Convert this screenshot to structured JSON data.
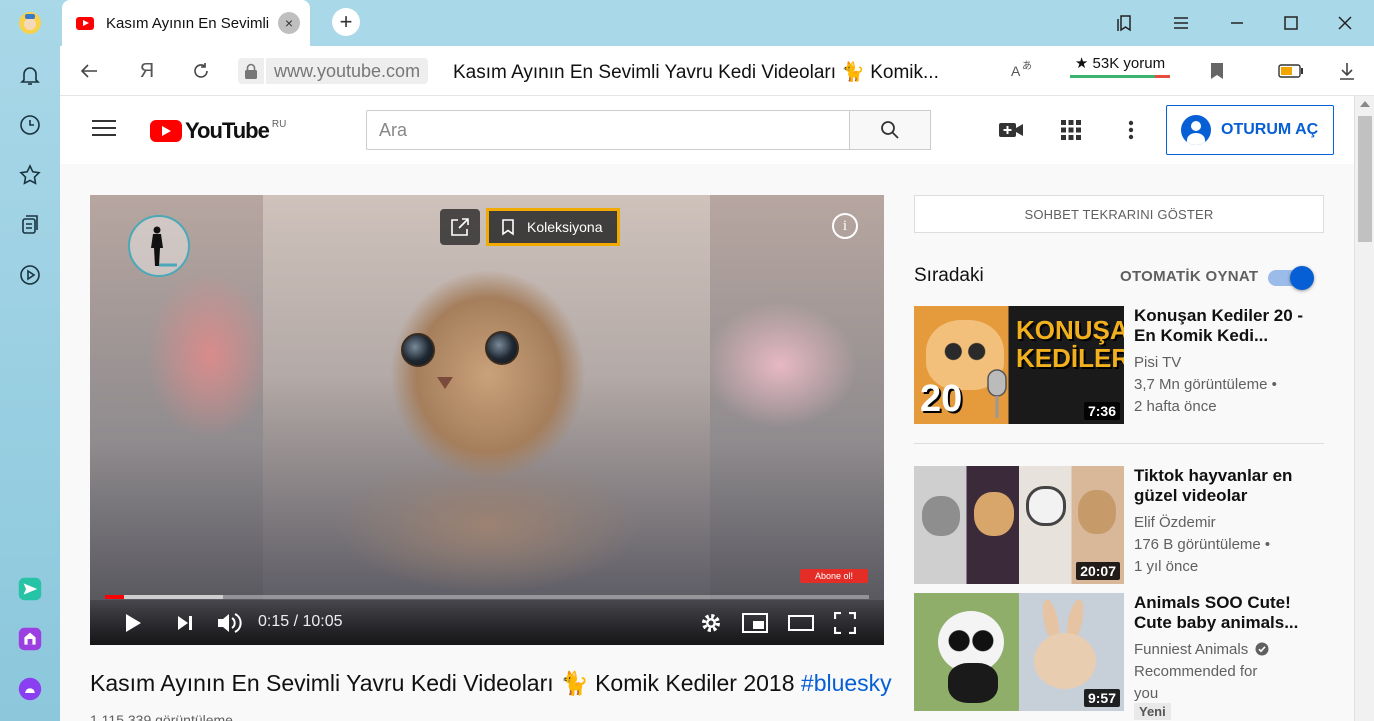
{
  "browser": {
    "tab_title": "Kasım Ayının En Sevimli",
    "tab_close": "×",
    "new_tab": "+",
    "domain": "www.youtube.com",
    "page_title": "Kasım Ayının En Sevimli Yavru Kedi Videoları 🐈 Komik...",
    "reviews": "★ 53K yorum",
    "yandex_letter": "Я"
  },
  "youtube": {
    "logo_text": "YouTube",
    "region": "RU",
    "search_placeholder": "Ara",
    "signin_label": "OTURUM AÇ"
  },
  "player": {
    "collection_label": "Koleksiyona",
    "info": "i",
    "subscribe_badge": "Abone ol!",
    "time": "0:15 / 10:05",
    "progress_played": 0.025,
    "progress_buffered": 0.155
  },
  "video": {
    "title": "Kasım Ayının En Sevimli Yavru Kedi Videoları 🐈 Komik Kediler 2018",
    "hashtag": "#bluesky",
    "views_partial": "1.115.339 görüntüleme"
  },
  "sidebar": {
    "chat_replay": "SOHBET TEKRARINI GÖSTER",
    "up_next": "Sıradaki",
    "autoplay_label": "OTOMATİK OYNAT",
    "autoplay_on": true,
    "recommendations": [
      {
        "title": "Konuşan Kediler 20 - En Komik Kedi...",
        "channel": "Pisi TV",
        "views": "3,7 Mn görüntüleme •",
        "age": "2 hafta önce",
        "duration": "7:36",
        "thumb_text": "KONUŞAN KEDİLER",
        "thumb_number": "20"
      },
      {
        "title": "Tiktok hayvanlar en güzel videolar",
        "channel": "Elif Özdemir",
        "views": "176 B görüntüleme •",
        "age": "1 yıl önce",
        "duration": "20:07"
      },
      {
        "title": "Animals SOO Cute! Cute baby animals...",
        "channel": "Funniest Animals",
        "views": "Recommended for",
        "age": "you",
        "duration": "9:57",
        "badge": "Yeni"
      }
    ]
  },
  "colors": {
    "accent_blue": "#065fd4",
    "youtube_red": "#ff0000",
    "collection_outline": "#f2a900"
  }
}
